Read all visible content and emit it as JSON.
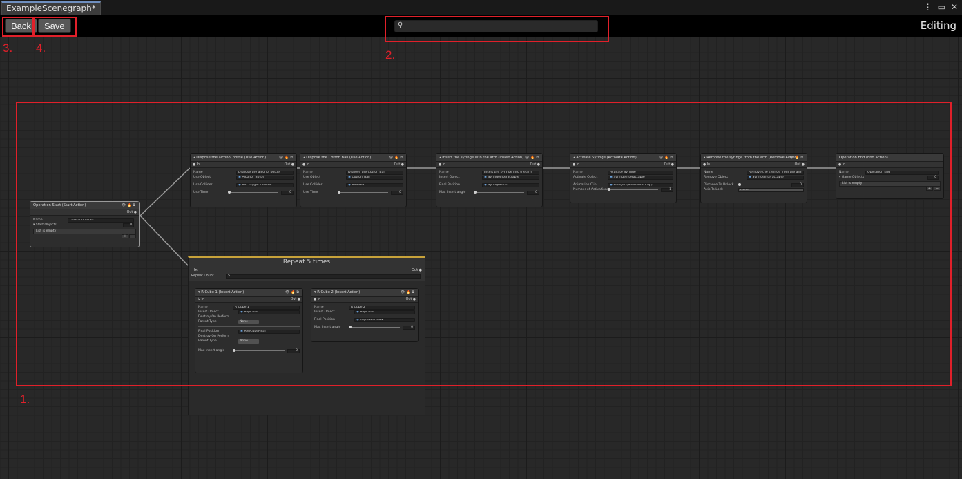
{
  "window": {
    "tab_title": "ExampleScenegraph*",
    "menu_icon": "kebab-menu-icon",
    "maximize_icon": "maximize-icon",
    "close_icon": "close-icon"
  },
  "toolbar": {
    "back_label": "Back",
    "save_label": "Save",
    "search_value": "",
    "mode_label": "Editing"
  },
  "annotations": {
    "n1": "1.",
    "n2": "2.",
    "n3": "3.",
    "n4": "4."
  },
  "node_icons": {
    "eye": "👁",
    "fire": "🔥",
    "copy": "⧉"
  },
  "nodes": {
    "start": {
      "title": "Operation Start (Start Action)",
      "out": "Out",
      "name_label": "Name",
      "name_value": "Operation start",
      "list_label": "Start Objects",
      "list_count": "0",
      "list_empty": "List is empty",
      "plus": "+",
      "minus": "−"
    },
    "dispose_bottle": {
      "title": "Dispose the alcohol bottle (Use Action)",
      "in": "In",
      "out": "Out",
      "name_label": "Name",
      "name_value": "Dispose the alcohol bottle",
      "use_object_label": "Use Object",
      "use_object_value": "Alcohol_Bottle",
      "use_collider_label": "Use Collider",
      "use_collider_value": "Bin Trigger Collider",
      "use_time_label": "Use Time",
      "use_time_value": "0"
    },
    "dispose_ball": {
      "title": "Dispose the Cotton Ball (Use Action)",
      "in": "In",
      "out": "Out",
      "name_label": "Name",
      "name_value": "Dispose the Cotton Ball",
      "use_object_label": "Use Object",
      "use_object_value": "Cotton_Ball",
      "use_collider_label": "Use Collider",
      "use_collider_value": "BinArea",
      "use_time_label": "Use Time",
      "use_time_value": "0"
    },
    "insert_syringe": {
      "title": "Insert the syringe into the arm (Insert Action)",
      "in": "In",
      "out": "Out",
      "name_label": "Name",
      "name_value": "Insert the syringe into the arm",
      "insert_object_label": "Insert Object",
      "insert_object_value": "SyringeInteractable",
      "final_position_label": "Final Position",
      "final_position_value": "SyringeFinal",
      "max_angle_label": "Max Insert angle",
      "max_angle_value": "0"
    },
    "activate_syringe": {
      "title": "Activate Syringe (Activate Action)",
      "in": "In",
      "out": "Out",
      "name_label": "Name",
      "name_value": "Activate Syringe",
      "activate_object_label": "Activate Object",
      "activate_object_value": "SyringeInteractable",
      "animation_clip_label": "Animation Clip",
      "animation_clip_value": "Plunger (Animation Clip)",
      "activations_label": "Number of Activations",
      "activations_value": "1"
    },
    "remove_syringe": {
      "title": "Remove the syringe from the arm (Remove Action)",
      "in": "In",
      "out": "Out",
      "name_label": "Name",
      "name_value": "Remove the syringe from the arm",
      "remove_object_label": "Remove Object",
      "remove_object_value": "SyringeInteractable",
      "distance_label": "Distance To Unlock",
      "distance_value": "0",
      "axis_label": "Axis To Lock",
      "axis_value": "None"
    },
    "end": {
      "title": "Operation End (End Action)",
      "in": "In",
      "name_label": "Name",
      "name_value": "Operation End",
      "list_label": "Game Objects",
      "list_count": "0",
      "list_empty": "List is empty",
      "plus": "+",
      "minus": "−"
    }
  },
  "repeat": {
    "title": "Repeat 5 times",
    "in": "In",
    "out": "Out",
    "count_label": "Repeat Count",
    "count_value": "5",
    "cube1": {
      "title": "R Cube 1 (Insert Action)",
      "in": "In",
      "out": "Out",
      "name_label": "Name",
      "name_value": "R Cube 1",
      "insert_object_label": "Insert Object",
      "insert_object_value": "RepCube",
      "destroy_label": "Destroy On Perform",
      "parent_type_label": "Parent Type",
      "parent_type_value": "None",
      "final_position_label": "Final Position",
      "final_position_value": "RepCubeFinal",
      "destroy2_label": "Destroy On Perform",
      "parent_type2_label": "Parent Type",
      "parent_type2_value": "None",
      "max_angle_label": "Max Insert angle",
      "max_angle_value": "0"
    },
    "cube2": {
      "title": "R Cube 2 (Insert Action)",
      "in": "In",
      "out": "Out",
      "name_label": "Name",
      "name_value": "R Cube 2",
      "insert_object_label": "Insert Object",
      "insert_object_value": "RepCube",
      "final_position_label": "Final Position",
      "final_position_value": "RepCubeFinal2",
      "max_angle_label": "Max Insert angle",
      "max_angle_value": "0"
    }
  }
}
